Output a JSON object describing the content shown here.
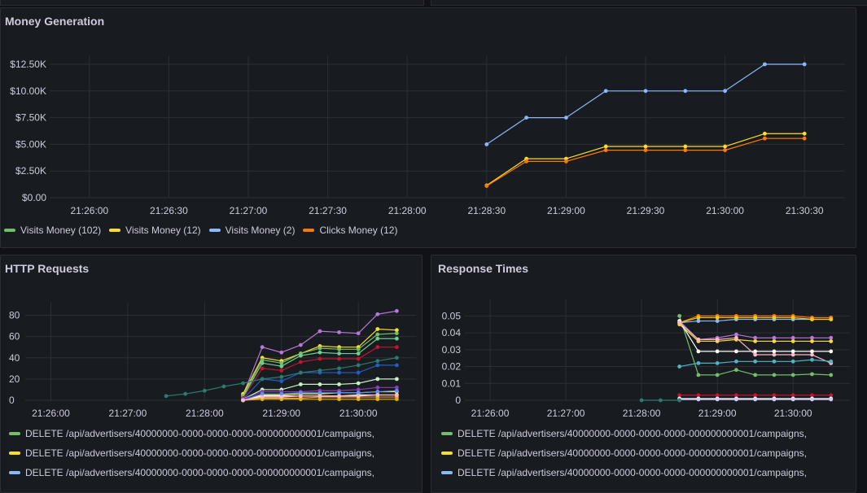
{
  "panels": {
    "money": {
      "title": "Money Generation"
    },
    "http": {
      "title": "HTTP Requests"
    },
    "response": {
      "title": "Response Times"
    }
  },
  "chart_data": [
    {
      "type": "line",
      "title": "Money Generation",
      "x_ticks": [
        "21:26:00",
        "21:26:30",
        "21:27:00",
        "21:27:30",
        "21:28:00",
        "21:28:30",
        "21:29:00",
        "21:29:30",
        "21:30:00",
        "21:30:30"
      ],
      "x_range": [
        "21:25:45",
        "21:30:45"
      ],
      "y_ticks": [
        "$0.00",
        "$2.50K",
        "$5.00K",
        "$7.50K",
        "$10.00K",
        "$12.50K"
      ],
      "ylim": [
        0,
        12500
      ],
      "grid": true,
      "legend_position": "bottom",
      "series": [
        {
          "name": "Visits Money (102)",
          "color": "#73bf69",
          "x": [],
          "values": []
        },
        {
          "name": "Visits Money (12)",
          "color": "#fade2a",
          "x": [
            "21:28:30",
            "21:28:45",
            "21:29:00",
            "21:29:15",
            "21:29:30",
            "21:29:45",
            "21:30:00",
            "21:30:15",
            "21:30:30"
          ],
          "values": [
            1150,
            3650,
            3650,
            4800,
            4800,
            4800,
            4800,
            6000,
            6000
          ]
        },
        {
          "name": "Visits Money (2)",
          "color": "#8ab8ff",
          "x": [
            "21:28:30",
            "21:28:45",
            "21:29:00",
            "21:29:15",
            "21:29:30",
            "21:29:45",
            "21:30:00",
            "21:30:15",
            "21:30:30"
          ],
          "values": [
            5000,
            7500,
            7500,
            10000,
            10000,
            10000,
            10000,
            12500,
            12500
          ]
        },
        {
          "name": "Clicks Money (12)",
          "color": "#ff780a",
          "x": [
            "21:28:30",
            "21:28:45",
            "21:29:00",
            "21:29:15",
            "21:29:30",
            "21:29:45",
            "21:30:00",
            "21:30:15",
            "21:30:30"
          ],
          "values": [
            1100,
            3400,
            3400,
            4450,
            4450,
            4450,
            4450,
            5550,
            5550
          ]
        }
      ]
    },
    {
      "type": "line",
      "title": "HTTP Requests",
      "x_ticks": [
        "21:26:00",
        "21:27:00",
        "21:28:00",
        "21:29:00",
        "21:30:00"
      ],
      "x_range": [
        "21:25:40",
        "21:30:45"
      ],
      "y_ticks": [
        "0",
        "20",
        "40",
        "60",
        "80"
      ],
      "ylim": [
        0,
        85
      ],
      "grid": true,
      "legend_position": "bottom",
      "legend": [
        {
          "label": "DELETE /api/advertisers/40000000-0000-0000-0000-000000000001/campaigns,",
          "color": "#73bf69"
        },
        {
          "label": "DELETE /api/advertisers/40000000-0000-0000-0000-000000000001/campaigns,",
          "color": "#fade2a"
        },
        {
          "label": "DELETE /api/advertisers/40000000-0000-0000-0000-000000000001/campaigns,",
          "color": "#8ab8ff"
        }
      ],
      "x": [
        "21:28:30",
        "21:28:45",
        "21:29:00",
        "21:29:15",
        "21:29:30",
        "21:29:45",
        "21:30:00",
        "21:30:15",
        "21:30:30"
      ],
      "series": [
        {
          "color": "#b877d9",
          "values": [
            5,
            50,
            45,
            52,
            65,
            64,
            63,
            81,
            84
          ]
        },
        {
          "color": "#fade2a",
          "values": [
            6,
            40,
            37,
            44,
            51,
            50,
            50,
            67,
            66
          ]
        },
        {
          "color": "#73bf69",
          "values": [
            4,
            38,
            35,
            44,
            49,
            48,
            48,
            62,
            63
          ]
        },
        {
          "color": "#6ccf8e",
          "values": [
            3,
            35,
            32,
            42,
            45,
            44,
            44,
            58,
            58
          ]
        },
        {
          "color": "#c4162a",
          "values": [
            2,
            30,
            28,
            36,
            39,
            39,
            39,
            50,
            50
          ]
        },
        {
          "color": "#1f60c4",
          "values": [
            1,
            20,
            18,
            26,
            26,
            26,
            26,
            33,
            33
          ]
        },
        {
          "color": "#c8f2c2",
          "values": [
            1,
            10,
            10,
            15,
            15,
            15,
            16,
            20,
            20
          ]
        },
        {
          "color": "#8f3bb8",
          "values": [
            1,
            8,
            8,
            8,
            9,
            9,
            10,
            12,
            12
          ]
        },
        {
          "color": "#ffee52",
          "values": [
            0,
            5,
            5,
            6,
            6,
            7,
            7,
            8,
            8
          ]
        },
        {
          "color": "#ff9830",
          "values": [
            0,
            2,
            2,
            2,
            3,
            3,
            3,
            3,
            3
          ]
        },
        {
          "color": "#e0b400",
          "values": [
            0,
            1,
            1,
            1,
            1,
            1,
            1,
            1,
            1
          ]
        },
        {
          "color": "#ffffff",
          "values": [
            0,
            4,
            4,
            4,
            4,
            4,
            5,
            5,
            5
          ]
        },
        {
          "color": "#5794f2",
          "values": [
            0,
            6,
            6,
            7,
            7,
            7,
            7,
            8,
            9
          ]
        },
        {
          "color": "#ffb8c6",
          "values": [
            0,
            3,
            3,
            4,
            4,
            4,
            4,
            5,
            5
          ]
        },
        {
          "color": "#2d7a70",
          "x": [
            "21:27:30",
            "21:27:45",
            "21:28:00",
            "21:28:15",
            "21:28:30",
            "21:28:45",
            "21:29:00",
            "21:29:15",
            "21:29:30",
            "21:29:45",
            "21:30:00",
            "21:30:15",
            "21:30:30"
          ],
          "values": [
            4,
            6,
            9,
            13,
            16,
            20,
            22,
            26,
            28,
            30,
            33,
            37,
            40
          ]
        }
      ]
    },
    {
      "type": "line",
      "title": "Response Times",
      "x_ticks": [
        "21:26:00",
        "21:27:00",
        "21:28:00",
        "21:29:00",
        "21:30:00"
      ],
      "x_range": [
        "21:25:40",
        "21:30:45"
      ],
      "y_ticks": [
        "0",
        "0.01",
        "0.02",
        "0.03",
        "0.04",
        "0.05"
      ],
      "ylim": [
        0,
        0.055
      ],
      "grid": true,
      "legend_position": "bottom",
      "legend": [
        {
          "label": "DELETE /api/advertisers/40000000-0000-0000-0000-000000000001/campaigns,",
          "color": "#73bf69"
        },
        {
          "label": "DELETE /api/advertisers/40000000-0000-0000-0000-000000000001/campaigns,",
          "color": "#fade2a"
        },
        {
          "label": "DELETE /api/advertisers/40000000-0000-0000-0000-000000000001/campaigns,",
          "color": "#8ab8ff"
        }
      ],
      "x": [
        "21:28:30",
        "21:28:45",
        "21:29:00",
        "21:29:15",
        "21:29:30",
        "21:29:45",
        "21:30:00",
        "21:30:15",
        "21:30:30"
      ],
      "series": [
        {
          "color": "#73bf69",
          "values": [
            0.05,
            0.015,
            0.015,
            0.018,
            0.015,
            0.015,
            0.015,
            0.0155,
            0.015
          ]
        },
        {
          "color": "#fade2a",
          "values": [
            0.045,
            0.035,
            0.035,
            0.036,
            0.035,
            0.035,
            0.035,
            0.035,
            0.035
          ]
        },
        {
          "color": "#ff780a",
          "values": [
            0.046,
            0.05,
            0.05,
            0.05,
            0.05,
            0.05,
            0.05,
            0.049,
            0.049
          ]
        },
        {
          "color": "#b877d9",
          "values": [
            0.047,
            0.036,
            0.037,
            0.039,
            0.037,
            0.037,
            0.037,
            0.037,
            0.037
          ]
        },
        {
          "color": "#8ab8ff",
          "values": [
            0.046,
            0.047,
            0.047,
            0.048,
            0.048,
            0.048,
            0.048,
            0.048,
            0.048
          ]
        },
        {
          "color": "#ffffff",
          "values": [
            0.047,
            0.029,
            0.029,
            0.029,
            0.029,
            0.029,
            0.029,
            0.029,
            0.029
          ]
        },
        {
          "color": "#f2cc0c",
          "values": [
            0.046,
            0.049,
            0.049,
            0.049,
            0.049,
            0.049,
            0.049,
            0.048,
            0.048
          ]
        },
        {
          "color": "#ffb8c6",
          "values": [
            0.046,
            0.036,
            0.036,
            0.037,
            0.027,
            0.027,
            0.027,
            0.027,
            0.022
          ]
        },
        {
          "color": "#4fb3c6",
          "values": [
            0.02,
            0.022,
            0.022,
            0.023,
            0.023,
            0.023,
            0.023,
            0.024,
            0.023
          ]
        },
        {
          "color": "#c4162a",
          "values": [
            0.003,
            0.003,
            0.003,
            0.003,
            0.003,
            0.003,
            0.003,
            0.003,
            0.003
          ]
        },
        {
          "color": "#ffffff",
          "values": [
            0.001,
            0.001,
            0.001,
            0.001,
            0.001,
            0.001,
            0.001,
            0.001,
            0.001
          ]
        },
        {
          "color": "#ccccff",
          "values": [
            0.0005,
            0.0005,
            0.0005,
            0.0005,
            0.0005,
            0.0005,
            0.0005,
            0.0005,
            0.0005
          ]
        },
        {
          "color": "#2d7a70",
          "x": [
            "21:28:00",
            "21:28:15",
            "21:28:30"
          ],
          "values": [
            0,
            0,
            0
          ]
        }
      ]
    }
  ]
}
